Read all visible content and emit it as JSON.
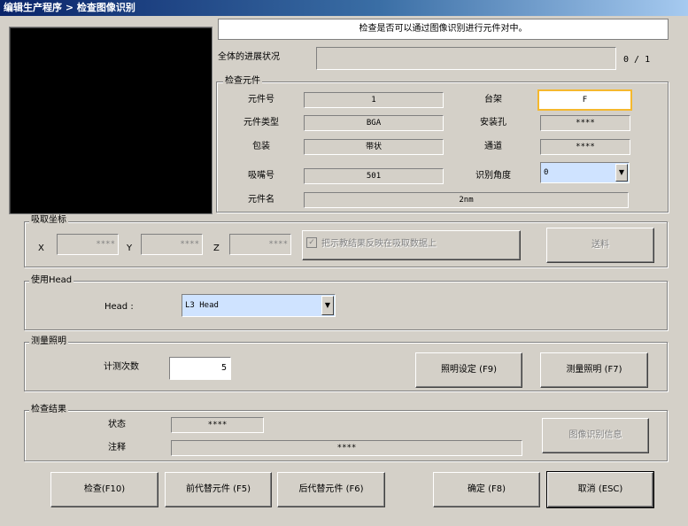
{
  "window": {
    "title": "编辑生产程序 > 检查图像识别"
  },
  "banner": {
    "text": "检查是否可以通过图像识别进行元件对中。"
  },
  "progress": {
    "label": "全体的进展状况",
    "count": "0 / 1"
  },
  "inspect_part": {
    "title": "检查元件",
    "part_no_label": "元件号",
    "part_no": "1",
    "part_type_label": "元件类型",
    "part_type": "BGA",
    "package_label": "包装",
    "package": "带状",
    "nozzle_label": "吸嘴号",
    "nozzle": "501",
    "part_name_label": "元件名",
    "part_name": "2nm",
    "rack_label": "台架",
    "rack": "F",
    "mount_hole_label": "安装孔",
    "mount_hole": "****",
    "channel_label": "通道",
    "channel": "****",
    "angle_label": "识别角度",
    "angle": "0"
  },
  "pick_coord": {
    "title": "吸取坐标",
    "x_label": "X",
    "x": "****",
    "y_label": "Y",
    "y": "****",
    "z_label": "Z",
    "z": "****",
    "reflect_label": "把示教结果反映在吸取数据上",
    "feed_button": "送料"
  },
  "head": {
    "title": "使用Head",
    "label": "Head  :",
    "value": "L3 Head"
  },
  "lighting": {
    "title": "测量照明",
    "count_label": "计测次数",
    "count": "5",
    "light_setting_button": "照明设定 (F9)",
    "measure_light_button": "测量照明 (F7)"
  },
  "result": {
    "title": "检查结果",
    "status_label": "状态",
    "status": "****",
    "note_label": "注释",
    "note": "****",
    "image_info_button": "图像识别信息"
  },
  "footer": {
    "inspect": "检查(F10)",
    "prev": "前代替元件 (F5)",
    "next": "后代替元件 (F6)",
    "ok": "确定 (F8)",
    "cancel": "取消 (ESC)"
  }
}
